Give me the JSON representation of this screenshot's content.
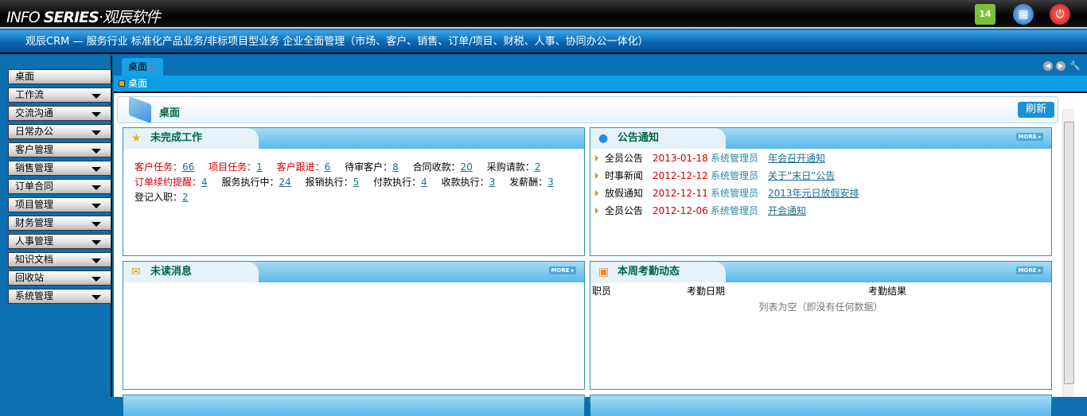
{
  "header": {
    "logo_light": "INFO ",
    "logo_bold": "SERIES",
    "logo_cn": "·观辰软件",
    "icons": [
      "calendar-icon",
      "calculator-icon",
      "power-icon"
    ],
    "calendar_day": "14"
  },
  "banner": "观辰CRM — 服务行业 标准化产品业务/非标项目型业务 企业全面管理（市场、客户、销售、订单/项目、财税、人事、协同办公一体化）",
  "sidebar": {
    "items": [
      {
        "label": "桌面"
      },
      {
        "label": "工作流"
      },
      {
        "label": "交流沟通"
      },
      {
        "label": "日常办公"
      },
      {
        "label": "客户管理"
      },
      {
        "label": "销售管理"
      },
      {
        "label": "订单合同"
      },
      {
        "label": "项目管理"
      },
      {
        "label": "财务管理"
      },
      {
        "label": "人事管理"
      },
      {
        "label": "知识文档"
      },
      {
        "label": "回收站"
      },
      {
        "label": "系统管理"
      }
    ]
  },
  "tabs": [
    {
      "label": "桌面",
      "close": "×"
    }
  ],
  "breadcrumb": "桌面",
  "page": {
    "title": "桌面",
    "refresh": "刷新"
  },
  "panels": {
    "work": {
      "title": "未完成工作",
      "items": [
        {
          "label": "客户任务：",
          "value": "66",
          "red": true
        },
        {
          "label": "项目任务：",
          "value": "1",
          "red": true
        },
        {
          "label": "客户跟进：",
          "value": "6",
          "red": true
        },
        {
          "label": "待审客户：",
          "value": "8",
          "red": false
        },
        {
          "label": "合同收款：",
          "value": "20",
          "red": false
        },
        {
          "label": "采购请款：",
          "value": "2",
          "red": false
        },
        {
          "label": "订单续约提醒：",
          "value": "4",
          "red": true
        },
        {
          "label": "服务执行中：",
          "value": "24",
          "red": false
        },
        {
          "label": "报销执行：",
          "value": "5",
          "red": false
        },
        {
          "label": "付款执行：",
          "value": "4",
          "red": false
        },
        {
          "label": "收款执行：",
          "value": "3",
          "red": false
        },
        {
          "label": "发薪酬：",
          "value": "3",
          "red": false
        },
        {
          "label": "登记入职：",
          "value": "2",
          "red": false
        }
      ]
    },
    "notice": {
      "title": "公告通知",
      "more": "MORE ▸",
      "rows": [
        {
          "category": "全员公告",
          "date": "2013-01-18",
          "publisher": "系统管理员",
          "subject": "年会召开通知"
        },
        {
          "category": "时事新闻",
          "date": "2012-12-12",
          "publisher": "系统管理员",
          "subject": "关于“末日”公告"
        },
        {
          "category": "放假通知",
          "date": "2012-12-11",
          "publisher": "系统管理员",
          "subject": "2013年元日放假安排"
        },
        {
          "category": "全员公告",
          "date": "2012-12-06",
          "publisher": "系统管理员",
          "subject": "开会通知"
        }
      ]
    },
    "messages": {
      "title": "未读消息",
      "more": "MORE ▸"
    },
    "attendance": {
      "title": "本周考勤动态",
      "more": "MORE ▸",
      "columns": [
        "职员",
        "考勤日期",
        "考勤结果"
      ],
      "empty": "列表为空（即没有任何数据）"
    }
  }
}
